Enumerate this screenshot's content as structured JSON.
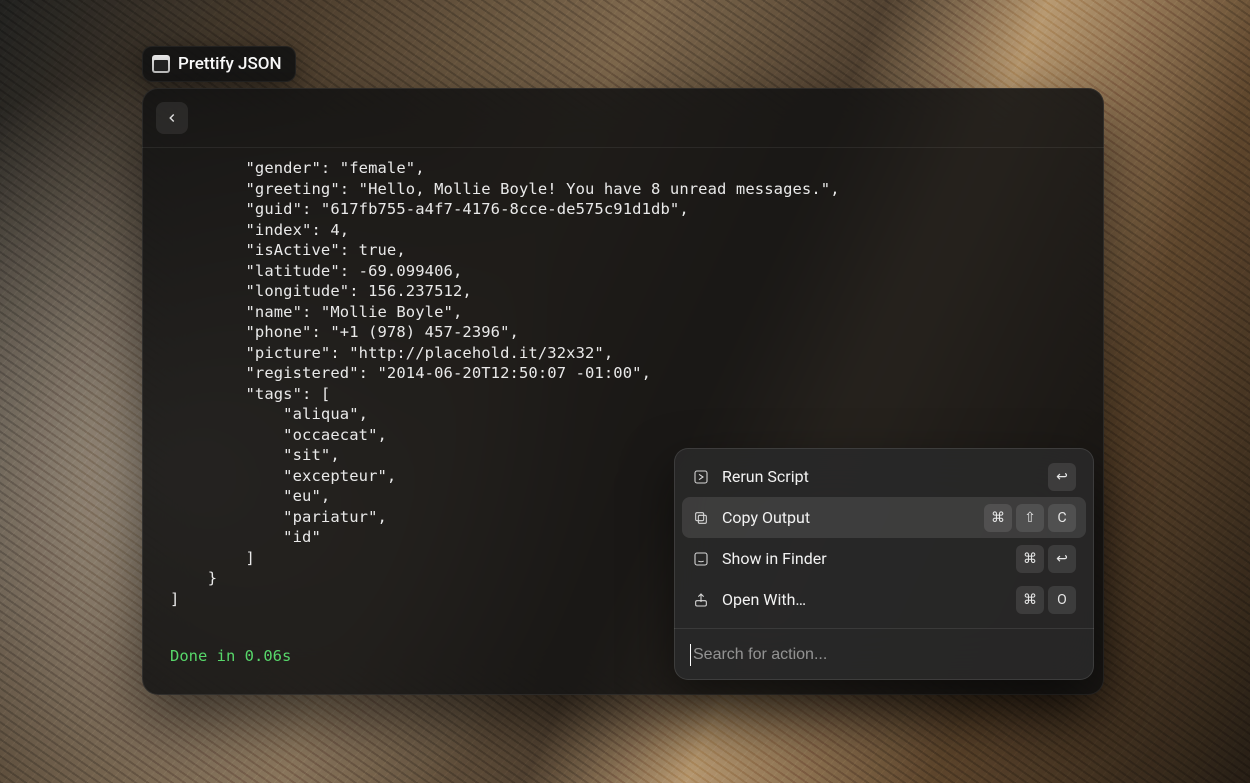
{
  "title": {
    "label": "Prettify JSON",
    "icon": "terminal-icon"
  },
  "output": {
    "json_text": "        \"gender\": \"female\",\n        \"greeting\": \"Hello, Mollie Boyle! You have 8 unread messages.\",\n        \"guid\": \"617fb755-a4f7-4176-8cce-de575c91d1db\",\n        \"index\": 4,\n        \"isActive\": true,\n        \"latitude\": -69.099406,\n        \"longitude\": 156.237512,\n        \"name\": \"Mollie Boyle\",\n        \"phone\": \"+1 (978) 457-2396\",\n        \"picture\": \"http://placehold.it/32x32\",\n        \"registered\": \"2014-06-20T12:50:07 -01:00\",\n        \"tags\": [\n            \"aliqua\",\n            \"occaecat\",\n            \"sit\",\n            \"excepteur\",\n            \"eu\",\n            \"pariatur\",\n            \"id\"\n        ]\n    }\n]",
    "status": "Done in 0.06s"
  },
  "actions": {
    "items": [
      {
        "icon": "play-square-icon",
        "label": "Rerun Script",
        "keys": [
          "↩"
        ],
        "highlight": false
      },
      {
        "icon": "copy-icon",
        "label": "Copy Output",
        "keys": [
          "⌘",
          "⇧",
          "C"
        ],
        "highlight": true
      },
      {
        "icon": "finder-icon",
        "label": "Show in Finder",
        "keys": [
          "⌘",
          "↩"
        ],
        "highlight": false
      },
      {
        "icon": "share-icon",
        "label": "Open With…",
        "keys": [
          "⌘",
          "O"
        ],
        "highlight": false
      }
    ],
    "search_placeholder": "Search for action..."
  }
}
